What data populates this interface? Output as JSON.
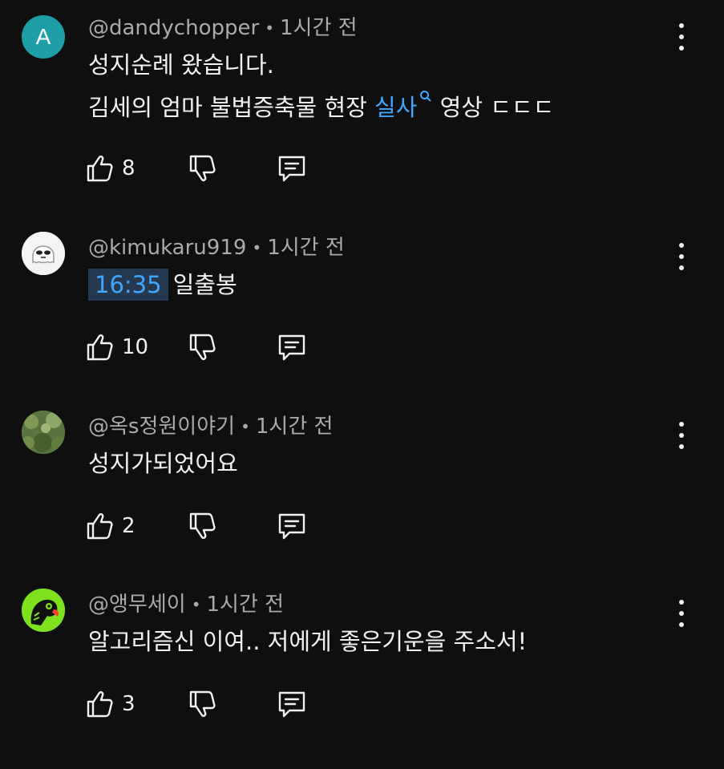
{
  "comments": [
    {
      "avatar_letter": "A",
      "avatar_color": "#1e9fa8",
      "author": "@dandychopper",
      "time": "1시간 전",
      "line1": "성지순례 왔습니다.",
      "line2_prefix": "김세의 엄마 불법증축물 현장 ",
      "line2_link": "실사",
      "line2_link_icon": "search-icon",
      "line2_suffix": " 영상 ㄷㄷㄷ",
      "likes": "8"
    },
    {
      "avatar_icon": "ghost-avatar",
      "author": "@kimukaru919",
      "time": "1시간 전",
      "timestamp": "16:35",
      "text": "일출봉",
      "likes": "10"
    },
    {
      "avatar_icon": "garden-avatar",
      "author": "@옥s정원이야기",
      "time": "1시간 전",
      "text": "성지가되었어요",
      "likes": "2"
    },
    {
      "avatar_icon": "parrot-avatar",
      "author": "@앵무세이",
      "time": "1시간 전",
      "text": "알고리즘신 이여.. 저에게 좋은기운을 주소서!",
      "likes": "3"
    }
  ],
  "colors": {
    "background": "#0f0f0f",
    "text": "#f1f1f1",
    "meta": "#aaaaaa",
    "link": "#3ea6ff",
    "timestamp_bg": "#263850"
  },
  "icons": {
    "like": "thumbs-up-icon",
    "dislike": "thumbs-down-icon",
    "reply": "reply-icon",
    "more": "more-vert-icon"
  }
}
